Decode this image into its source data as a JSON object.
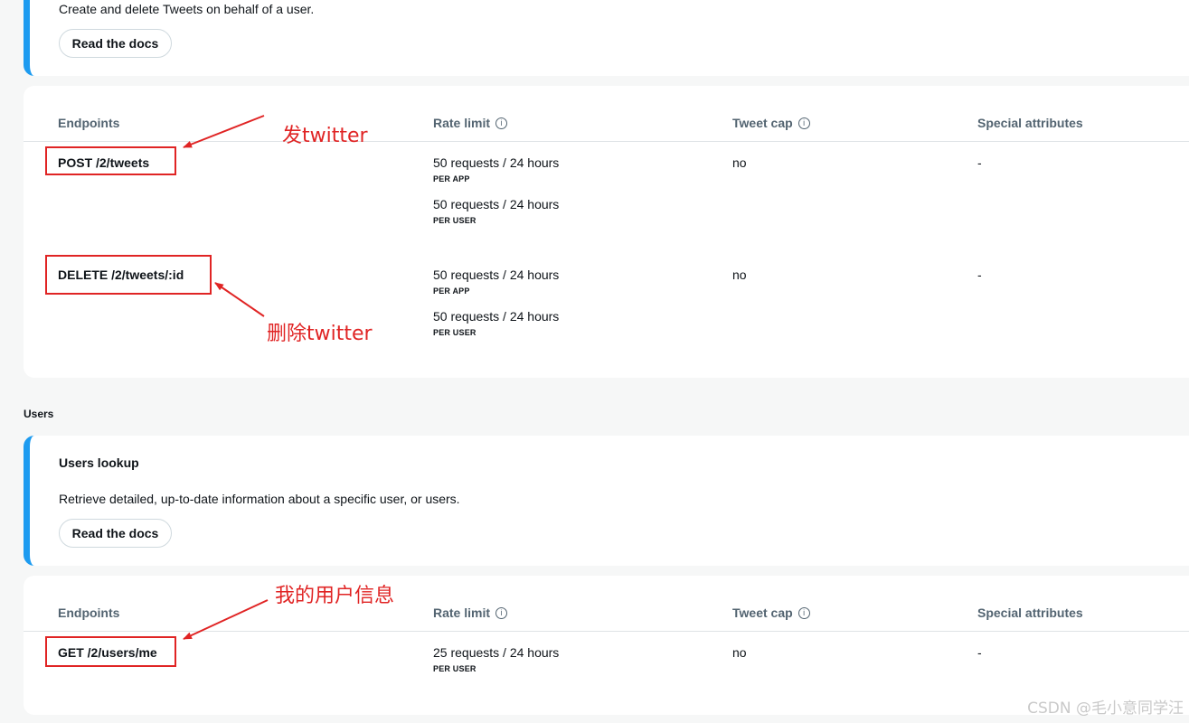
{
  "tweets_section": {
    "description": "Create and delete Tweets on behalf of a user.",
    "docs_button": "Read the docs"
  },
  "table_headers": {
    "endpoints": "Endpoints",
    "rate_limit": "Rate limit",
    "tweet_cap": "Tweet cap",
    "special": "Special attributes",
    "info_glyph": "i"
  },
  "tweet_endpoints": [
    {
      "path": "POST /2/tweets",
      "limits": [
        {
          "rate": "50 requests / 24 hours",
          "scope": "PER APP"
        },
        {
          "rate": "50 requests / 24 hours",
          "scope": "PER USER"
        }
      ],
      "cap": "no",
      "special": "-"
    },
    {
      "path": "DELETE /2/tweets/:id",
      "limits": [
        {
          "rate": "50 requests / 24 hours",
          "scope": "PER APP"
        },
        {
          "rate": "50 requests / 24 hours",
          "scope": "PER USER"
        }
      ],
      "cap": "no",
      "special": "-"
    }
  ],
  "users_section": {
    "label": "Users",
    "title": "Users lookup",
    "description": "Retrieve detailed, up-to-date information about a specific user, or users.",
    "docs_button": "Read the docs"
  },
  "user_endpoints": [
    {
      "path": "GET /2/users/me",
      "limits": [
        {
          "rate": "25 requests / 24 hours",
          "scope": "PER USER"
        }
      ],
      "cap": "no",
      "special": "-"
    }
  ],
  "annotations": {
    "post": "发twitter",
    "delete": "删除twitter",
    "me": "我的用户信息"
  },
  "colors": {
    "accent": "#1d9bf0",
    "annotation": "#e02424"
  },
  "watermark": "CSDN @毛小意同学汪"
}
